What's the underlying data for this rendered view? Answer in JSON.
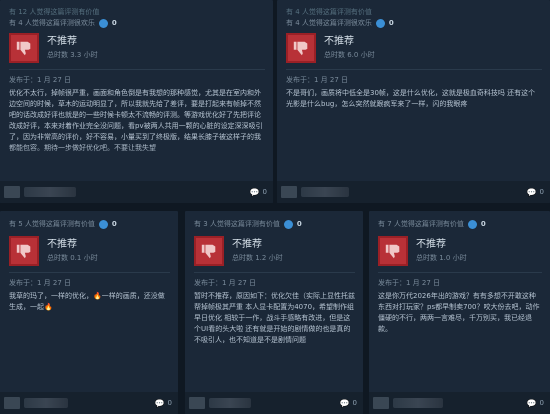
{
  "reviews": [
    {
      "helpful": "有 12 人觉得这篇评测有价值",
      "funny": "有 4 人觉得这篇评测很欢乐",
      "award_count": "0",
      "verdict": "不推荐",
      "hours": "总时数 3.3 小时",
      "posted": "发布于：1 月 27 日",
      "text": "优化不太行，掉帧很严重，画面和角色倒是有我想的那种感觉，尤其是在室内和外边空间的时候，草木的运动明显了，所以我就先给了差评，要是打起来有帧掉不然吧的话改成好评也就是的一些时候卡顿太不流畅的评测。等游戏优化好了先把评论改成好评，本来对着作业完全没问题，看pv被两人共用一颗的心脏的设定深深吸引了，因为非常高的评价，好不容易，小量买到了终极版，结果长膝子被这样子的我都能包容。期待一步做好优化吧。不要让我失望",
      "comments": "0"
    },
    {
      "helpful": "有 4 人觉得这篇评测有价值",
      "funny": "有 4 人觉得这篇评测很欢乐",
      "award_count": "0",
      "verdict": "不推荐",
      "hours": "总时数 6.0 小时",
      "posted": "发布于：1 月 27 日",
      "text": "不是哥们，画质将中低全是30帧，这是什么优化，这就是极血奇科技吗 还有这个光影是什么bug，怎么突然就跟疯军来了一样，闪的我眼疼",
      "comments": "0"
    },
    {
      "helpful": "有 5 人觉得这篇评测有价值",
      "award_count": "0",
      "verdict": "不推荐",
      "hours": "总时数 0.1 小时",
      "posted": "发布于：1 月 27 日",
      "text": "我草的玛了，一样的优化，🔥一样的画质，还没做生成，一起🔥",
      "comments": "0"
    },
    {
      "helpful": "有 3 人觉得这篇评测有价值",
      "award_count": "0",
      "verdict": "不推荐",
      "hours": "总时数 1.2 小时",
      "posted": "发布于：1 月 27 日",
      "text": "暂时不推荐，原因如下：优化欠佳（实际上显性托兹帮掉帧极其严重 本人显卡配置为4070，希望制作组早日优化 相较于一作，战斗手感略有改进，但是这个UI看的头大啦 还有就是开始的剧情做的也是真的不吸引人，也不知道是不是剧情问题",
      "comments": "0"
    },
    {
      "helpful": "有 7 人觉得这篇评测有价值",
      "award_count": "0",
      "verdict": "不推荐",
      "hours": "总时数 1.0 小时",
      "posted": "发布于：1 月 27 日",
      "text": "这是你万代2026年出的游戏？有有多想不开敢这种东西对打玩家？ps都早制卖700？咬大份去吧，动作僵硬的不行，两两一言难尽，千万别买，我已经退款。",
      "comments": "0"
    }
  ]
}
